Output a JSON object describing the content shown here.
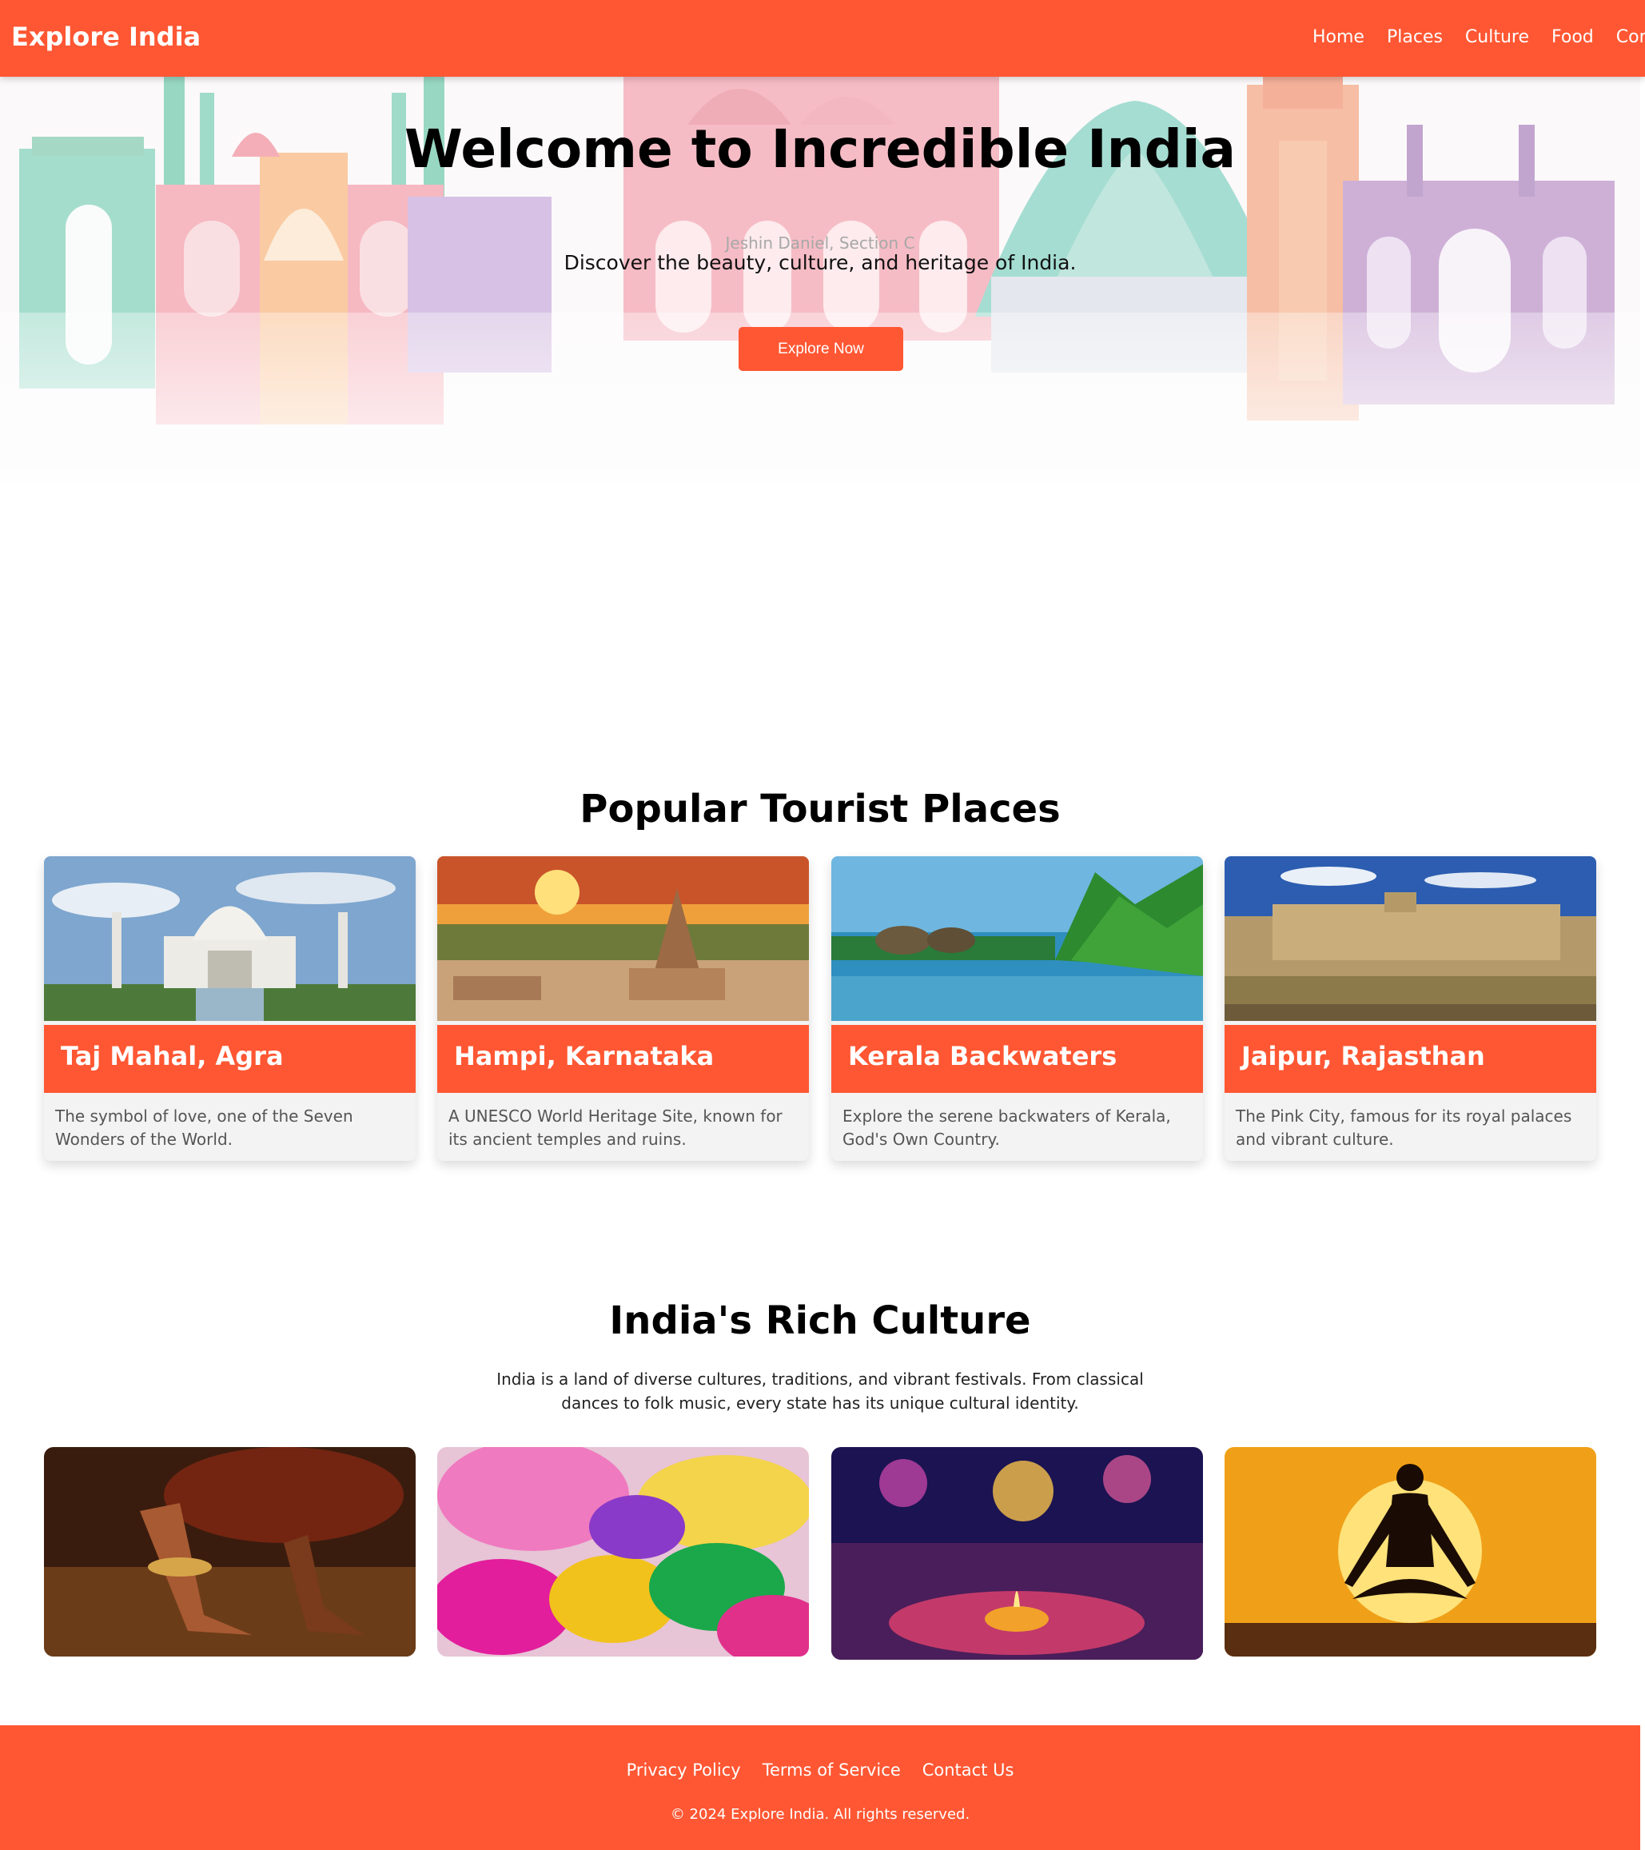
{
  "header": {
    "brand": "Explore India",
    "nav": [
      "Home",
      "Places",
      "Culture",
      "Food",
      "Contac"
    ]
  },
  "hero": {
    "title": "Welcome to Incredible India",
    "author": "Jeshin Daniel, Section C",
    "subtitle": "Discover the beauty, culture, and heritage of India.",
    "button_label": "Explore Now"
  },
  "places": {
    "title": "Popular Tourist Places",
    "cards": [
      {
        "title": "Taj Mahal, Agra",
        "description": "The symbol of love, one of the Seven Wonders of the World."
      },
      {
        "title": "Hampi, Karnataka",
        "description": "A UNESCO World Heritage Site, known for its ancient temples and ruins."
      },
      {
        "title": "Kerala Backwaters",
        "description": "Explore the serene backwaters of Kerala, God's Own Country."
      },
      {
        "title": "Jaipur, Rajasthan",
        "description": "The Pink City, famous for its royal palaces and vibrant culture."
      }
    ]
  },
  "culture": {
    "title": "India's Rich Culture",
    "text": "India is a land of diverse cultures, traditions, and vibrant festivals. From classical dances to folk music, every state has its unique cultural identity."
  },
  "footer": {
    "links": [
      "Privacy Policy",
      "Terms of Service",
      "Contact Us"
    ],
    "copyright": "© 2024 Explore India. All rights reserved."
  },
  "colors": {
    "accent": "#ff5733",
    "card_bg": "#f3f3f3"
  }
}
